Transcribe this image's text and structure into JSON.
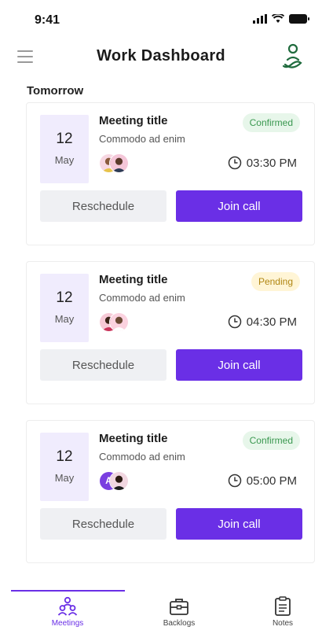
{
  "status_bar": {
    "time": "9:41"
  },
  "header": {
    "title": "Work Dashboard"
  },
  "section": {
    "title": "Tomorrow"
  },
  "meetings": [
    {
      "day": "12",
      "month": "May",
      "title": "Meeting title",
      "subtitle": "Commodo ad enim",
      "status": "Confirmed",
      "status_type": "confirmed",
      "time": "03:30 PM",
      "avatar_letter": ""
    },
    {
      "day": "12",
      "month": "May",
      "title": "Meeting title",
      "subtitle": "Commodo ad enim",
      "status": "Pending",
      "status_type": "pending",
      "time": "04:30 PM",
      "avatar_letter": ""
    },
    {
      "day": "12",
      "month": "May",
      "title": "Meeting title",
      "subtitle": "Commodo ad enim",
      "status": "Confirmed",
      "status_type": "confirmed",
      "time": "05:00 PM",
      "avatar_letter": "A"
    }
  ],
  "buttons": {
    "reschedule": "Reschedule",
    "join": "Join call"
  },
  "tabs": [
    {
      "label": "Meetings",
      "icon": "people-icon",
      "active": true
    },
    {
      "label": "Backlogs",
      "icon": "briefcase-icon",
      "active": false
    },
    {
      "label": "Notes",
      "icon": "clipboard-icon",
      "active": false
    }
  ],
  "colors": {
    "accent": "#6a2fe6",
    "date_bg": "#f0ecfd",
    "confirmed": "#3a9850",
    "pending": "#b08612"
  }
}
